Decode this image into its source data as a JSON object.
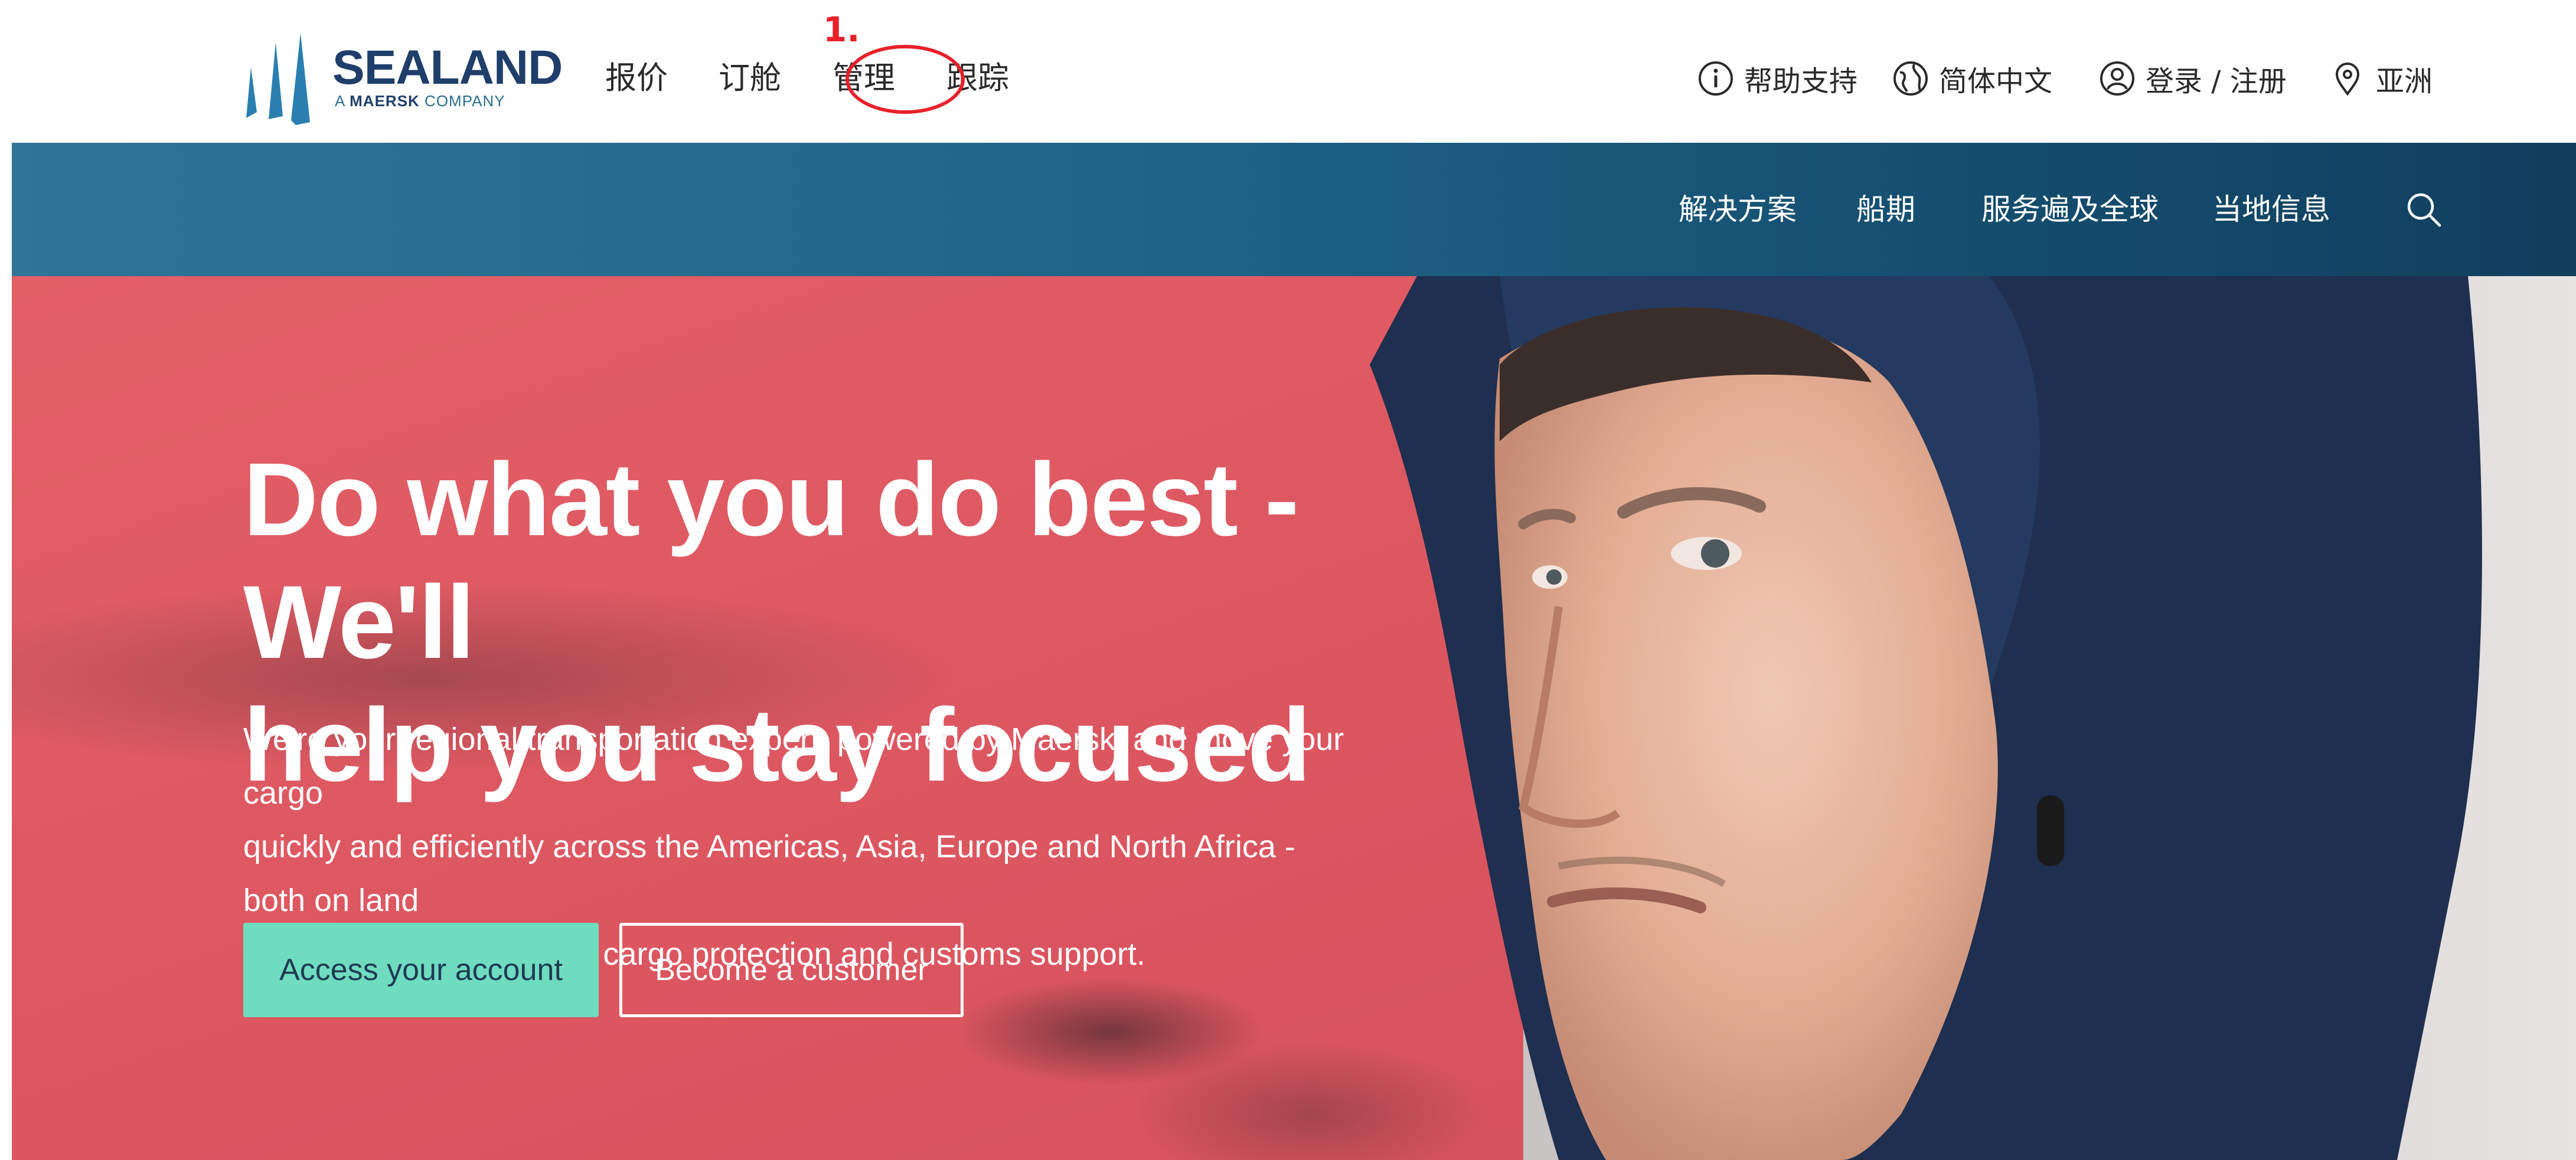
{
  "brand": {
    "name": "SEALAND",
    "tagline_part1": "A ",
    "tagline_bold": "MAERSK",
    "tagline_part2": " COMPANY",
    "color": "#1f3e6b"
  },
  "primary_nav": {
    "items": [
      {
        "id": "quote",
        "label": "报价"
      },
      {
        "id": "book",
        "label": "订舱"
      },
      {
        "id": "manage",
        "label": "管理"
      },
      {
        "id": "track",
        "label": "跟踪"
      }
    ]
  },
  "annotation": {
    "label": "1.",
    "color": "#e8202a"
  },
  "utility_nav": {
    "help": {
      "label": "帮助支持",
      "icon": "info-icon"
    },
    "language": {
      "label": "简体中文",
      "icon": "globe-icon"
    },
    "account": {
      "label": "登录 / 注册",
      "icon": "user-icon"
    },
    "region": {
      "label": "亚洲",
      "icon": "location-pin-icon"
    }
  },
  "secondary_nav": {
    "items": [
      {
        "id": "solutions",
        "label": "解决方案"
      },
      {
        "id": "schedules",
        "label": "船期"
      },
      {
        "id": "global",
        "label": "服务遍及全球"
      },
      {
        "id": "local",
        "label": "当地信息"
      }
    ],
    "search_icon": "search-icon"
  },
  "hero": {
    "title_line1": "Do what you do best - We'll",
    "title_line2": "help you stay focused",
    "text_line1": "We're your regional transportation expert, powered by Maersk, and move your cargo",
    "text_line2": "quickly and efficiently across the Americas, Asia, Europe and North Africa - both on land",
    "text_line3": "and at sea, supported by cargo protection and customs support.",
    "primary_button": "Access your account",
    "secondary_button": "Become a customer",
    "accent_color": "#6fdcbf",
    "background_color": "#e05a62"
  },
  "colors": {
    "nav_band_start": "#2f7595",
    "nav_band_end": "#113f5e",
    "text_dark": "#2a2a2a"
  }
}
